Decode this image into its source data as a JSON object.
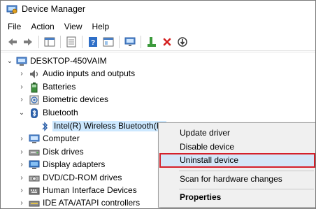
{
  "window": {
    "title": "Device Manager"
  },
  "menubar": {
    "items": [
      "File",
      "Action",
      "View",
      "Help"
    ]
  },
  "toolbar": {
    "buttons": [
      "back-arrow-icon",
      "forward-arrow-icon",
      "show-hide-tree-icon",
      "properties-icon",
      "help-icon",
      "device-details-icon",
      "scan-computer-icon",
      "update-driver-icon",
      "uninstall-x-icon",
      "download-icon"
    ]
  },
  "tree": {
    "root": "DESKTOP-450VAIM",
    "categories": [
      {
        "label": "Audio inputs and outputs",
        "icon": "speaker-icon",
        "expanded": false
      },
      {
        "label": "Batteries",
        "icon": "battery-icon",
        "expanded": false
      },
      {
        "label": "Biometric devices",
        "icon": "biometric-icon",
        "expanded": false
      },
      {
        "label": "Bluetooth",
        "icon": "bluetooth-icon",
        "expanded": true
      },
      {
        "label": "Computer",
        "icon": "computer-icon",
        "expanded": false
      },
      {
        "label": "Disk drives",
        "icon": "disk-icon",
        "expanded": false
      },
      {
        "label": "Display adapters",
        "icon": "display-icon",
        "expanded": false
      },
      {
        "label": "DVD/CD-ROM drives",
        "icon": "dvd-icon",
        "expanded": false
      },
      {
        "label": "Human Interface Devices",
        "icon": "hid-icon",
        "expanded": false
      },
      {
        "label": "IDE ATA/ATAPI controllers",
        "icon": "ide-icon",
        "expanded": false
      }
    ],
    "bluetooth_child": "Intel(R) Wireless Bluetooth(R)"
  },
  "context_menu": {
    "items": [
      "Update driver",
      "Disable device",
      "Uninstall device",
      "Scan for hardware changes",
      "Properties"
    ],
    "highlighted": "Uninstall device",
    "highlight_border_color": "#d5202a"
  }
}
